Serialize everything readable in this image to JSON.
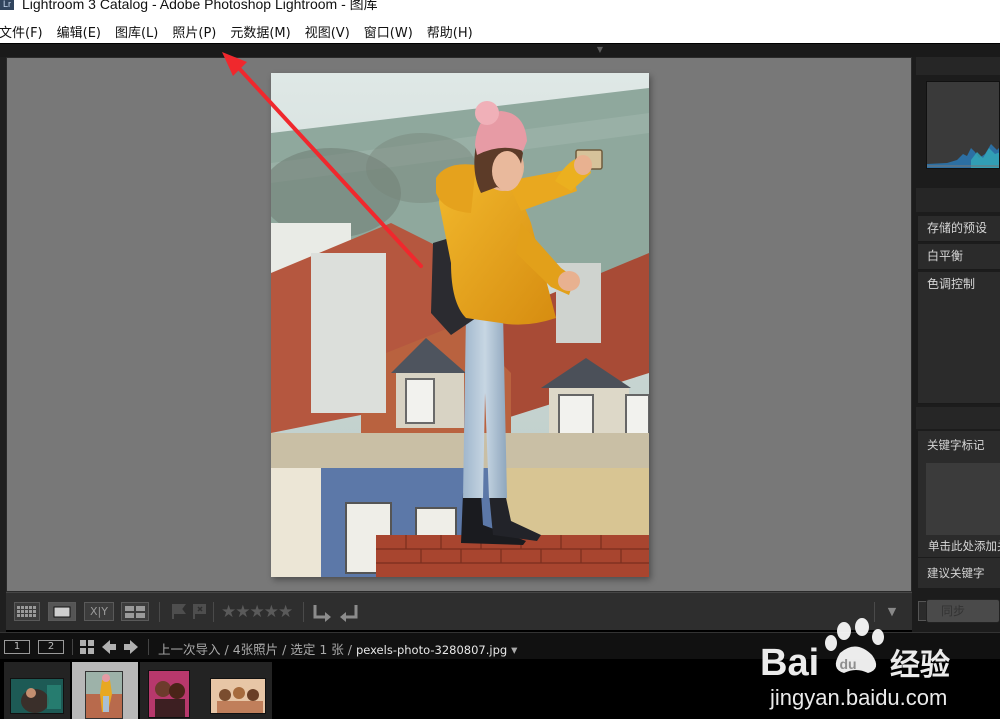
{
  "window": {
    "icon_text": "Lr",
    "title": "Lightroom 3 Catalog - Adobe Photoshop Lightroom - 图库"
  },
  "menu": [
    {
      "label": "文件(F)"
    },
    {
      "label": "编辑(E)"
    },
    {
      "label": "图库(L)"
    },
    {
      "label": "照片(P)"
    },
    {
      "label": "元数据(M)"
    },
    {
      "label": "视图(V)"
    },
    {
      "label": "窗口(W)"
    },
    {
      "label": "帮助(H)"
    }
  ],
  "toolbar": {
    "grid_view": "grid-icon",
    "loupe_view": "loupe-icon",
    "compare_view_label": "X|Y",
    "survey_view": "survey-icon",
    "rating_stars": "★★★★★",
    "rating_value": 0
  },
  "right_panel": {
    "sections": [
      {
        "label": "存储的预设"
      },
      {
        "label": "白平衡"
      },
      {
        "label": "色调控制"
      }
    ],
    "keywording_label": "关键字标记",
    "keyword_placeholder": "单击此处添加关",
    "suggested_keywords": "建议关键字",
    "sync_label": "同步"
  },
  "filmstrip_header": {
    "monitor_1": "1",
    "monitor_2": "2",
    "source": "上一次导入",
    "count": "4张照片",
    "selected": "选定 1 张",
    "separator": "/",
    "filename": "pexels-photo-3280807.jpg",
    "dropdown": "▾"
  },
  "filmstrip": {
    "thumbnails": [
      {
        "name": "thumb-1",
        "state": "normal"
      },
      {
        "name": "thumb-2",
        "state": "selected"
      },
      {
        "name": "thumb-3",
        "state": "normal"
      },
      {
        "name": "thumb-4",
        "state": "normal"
      }
    ]
  },
  "watermark": {
    "brand_en": "Bai",
    "brand_paw": "du",
    "brand_cn": "经验",
    "url": "jingyan.baidu.com"
  },
  "colors": {
    "annotation_arrow": "#f0282d",
    "canvas_bg": "#787878",
    "panel_bg": "#1c1c1c"
  }
}
